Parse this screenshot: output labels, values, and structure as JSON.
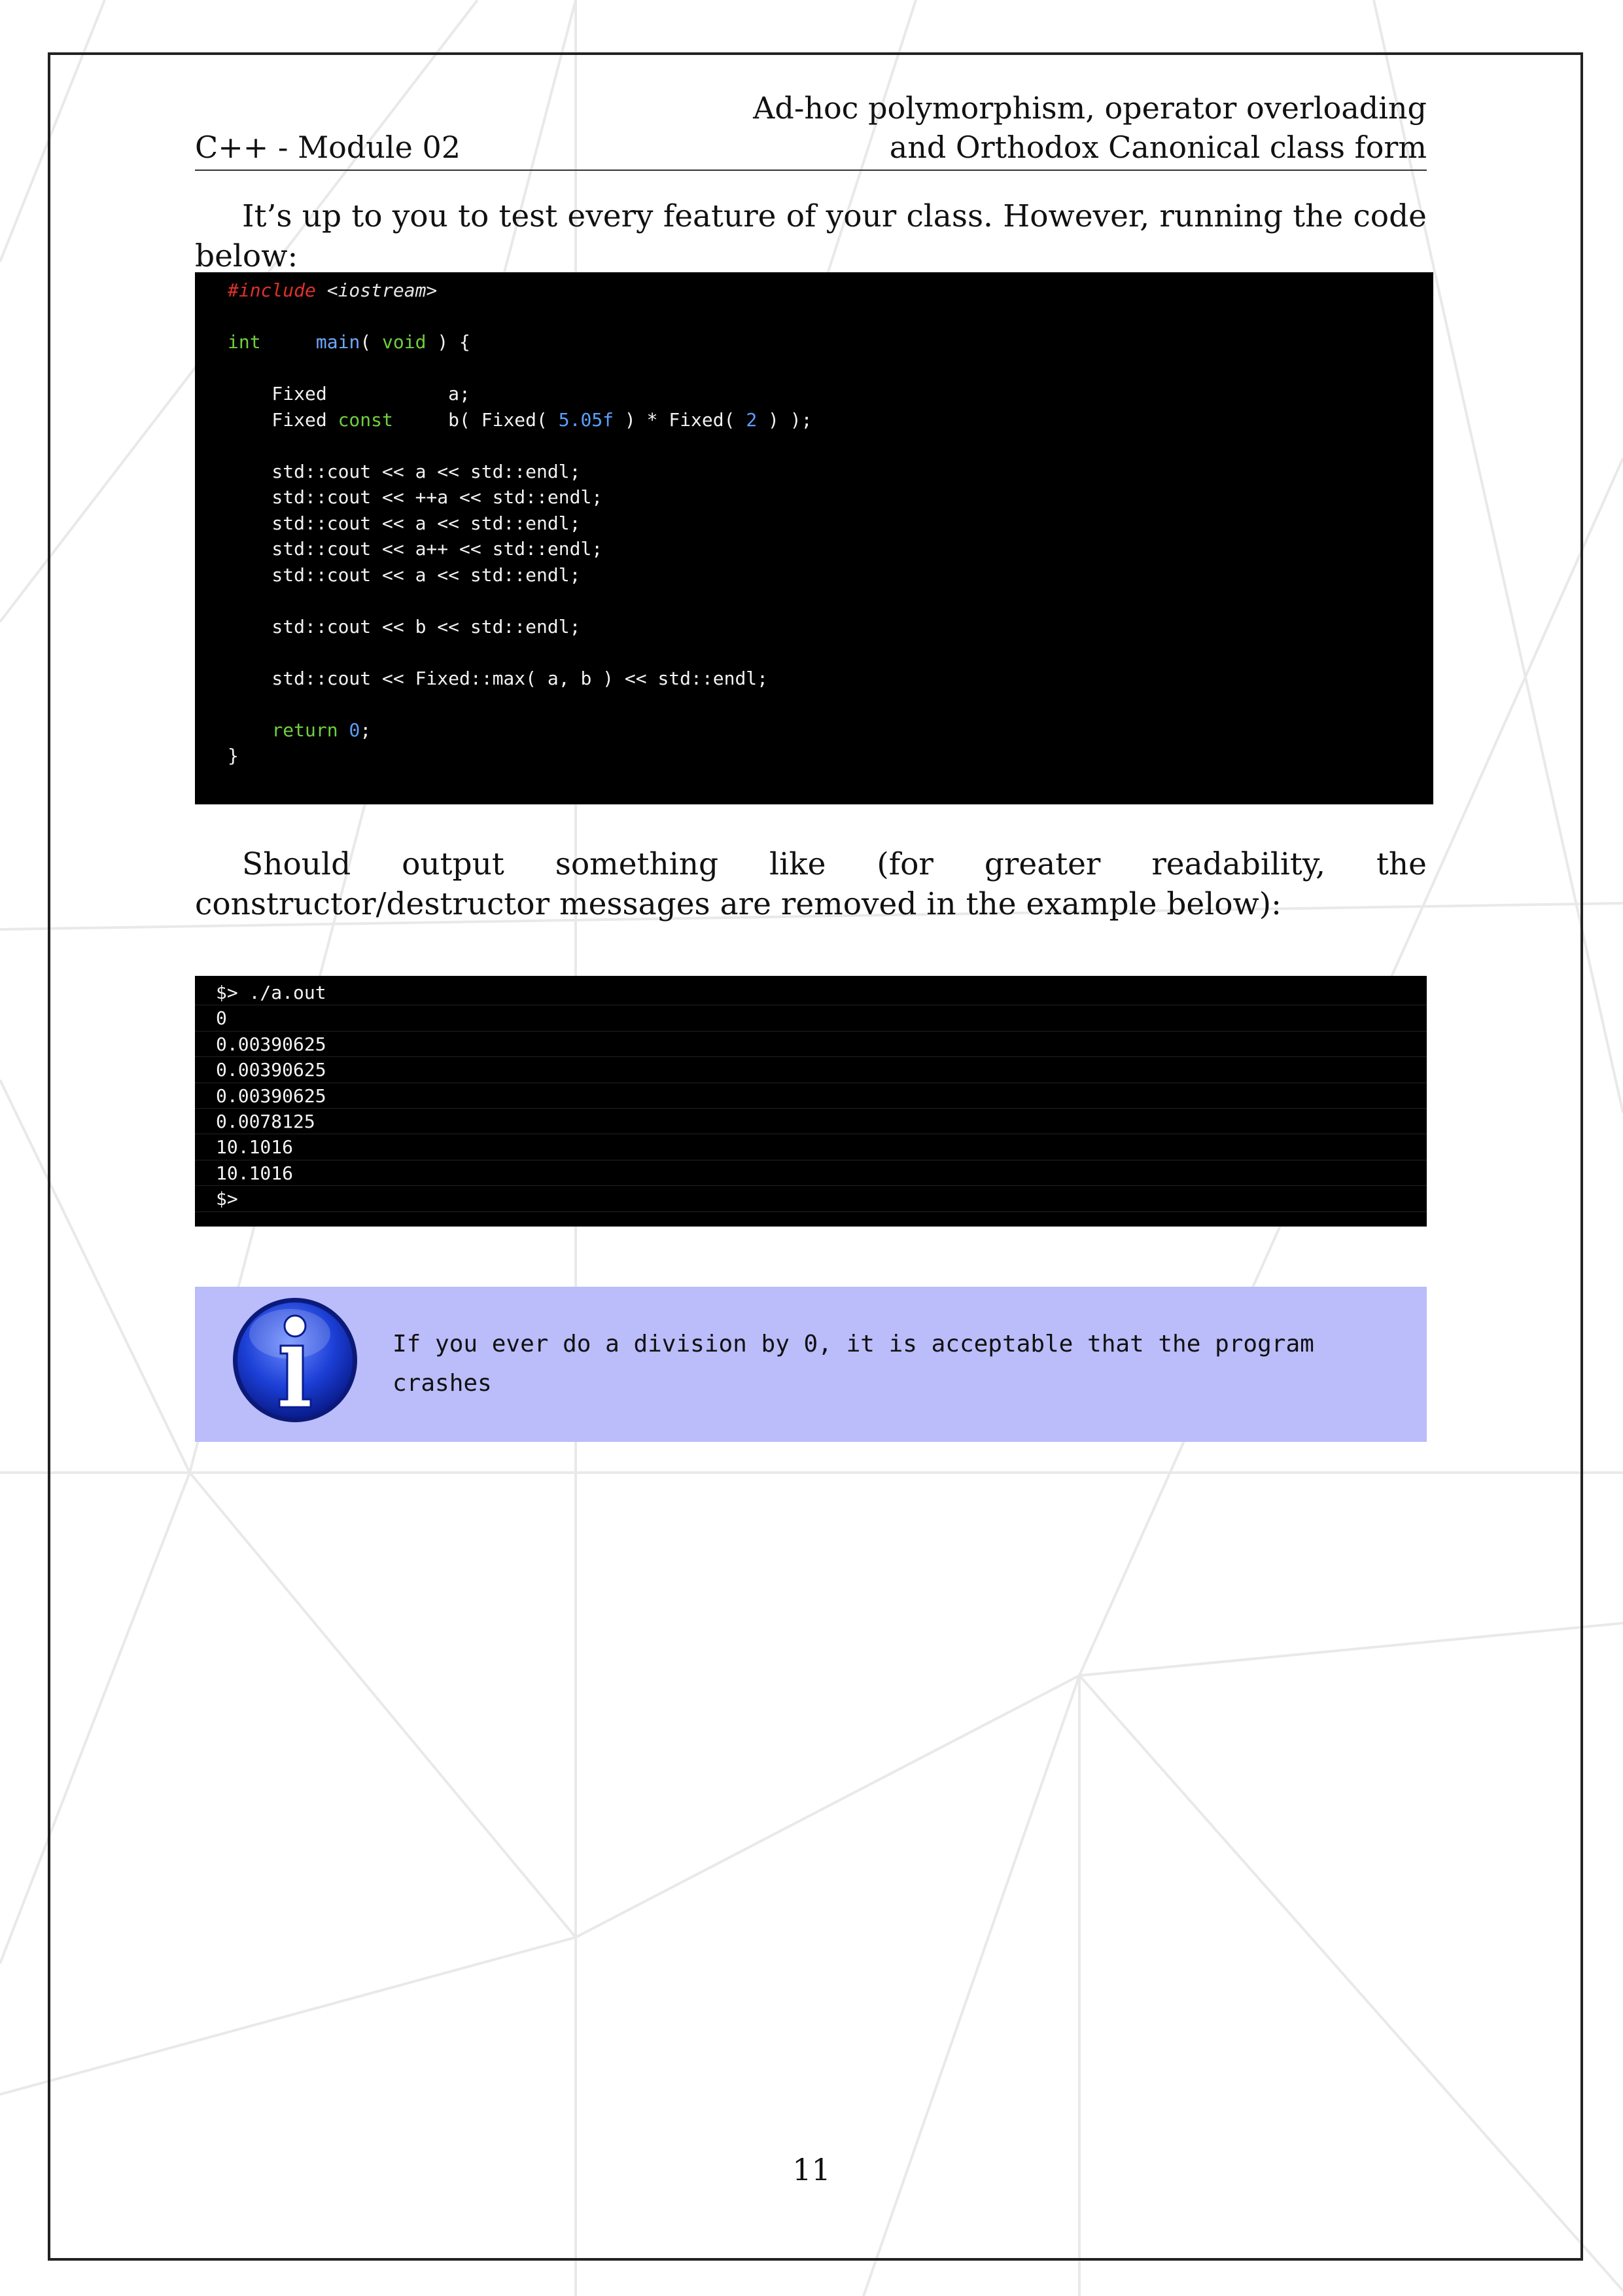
{
  "header": {
    "left": "C++ - Module 02",
    "right_line1": "Ad-hoc polymorphism, operator overloading",
    "right_line2": "and Orthodox Canonical class form"
  },
  "intro_text": "It’s up to you to test every feature of your class. However, running the code below:",
  "code": {
    "include_directive": "#include",
    "include_header": "<iostream>",
    "main_type": "int",
    "main_name": "main",
    "main_paren_open": "( ",
    "main_void": "void",
    "main_paren_close": " ) {",
    "decl_a": "    Fixed           a;",
    "decl_b_type": "    Fixed ",
    "decl_b_const": "const",
    "decl_b_mid": "     b( Fixed( ",
    "decl_b_num1": "5.05f",
    "decl_b_mid2": " ) * Fixed( ",
    "decl_b_num2": "2",
    "decl_b_end": " ) );",
    "stmt_1": "    std::cout << a << std::endl;",
    "stmt_2": "    std::cout << ++a << std::endl;",
    "stmt_3": "    std::cout << a << std::endl;",
    "stmt_4": "    std::cout << a++ << std::endl;",
    "stmt_5": "    std::cout << a << std::endl;",
    "stmt_6": "    std::cout << b << std::endl;",
    "stmt_7": "    std::cout << Fixed::max( a, b ) << std::endl;",
    "return_kw": "return",
    "return_val": "0",
    "close_brace": "}"
  },
  "output_intro": "Should output something like (for greater readability, the constructor/destructor messages are removed in the example below):",
  "terminal": [
    "$> ./a.out",
    "0",
    "0.00390625",
    "0.00390625",
    "0.00390625",
    "0.0078125",
    "10.1016",
    "10.1016",
    "$>"
  ],
  "info_note": "If you ever do a division by 0, it is acceptable that the program crashes",
  "page_number": "11",
  "colors": {
    "code_background": "#000000",
    "info_background": "#bbbcfa",
    "keyword_green": "#6fcf3f",
    "function_blue": "#6ea8ff",
    "preprocessor_red": "#e0302c"
  },
  "icons": {
    "info": "info-icon"
  }
}
